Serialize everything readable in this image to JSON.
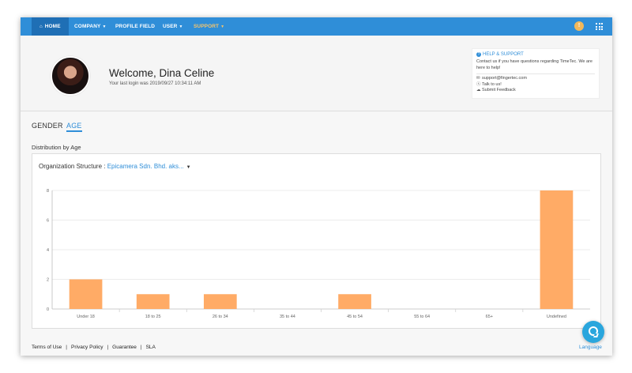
{
  "nav": {
    "home": "HOME",
    "company": "COMPANY",
    "profile_field": "PROFILE FIELD",
    "user": "USER",
    "support": "SUPPORT",
    "caret": "▼",
    "home_icon": "⌂"
  },
  "colors": {
    "nav_bg": "#2f8ed8",
    "nav_active": "#1f6fb5",
    "support_text": "#f6c56b",
    "bar": "#ffab66",
    "link": "#2f8ed8"
  },
  "welcome": {
    "title": "Welcome, Dina Celine",
    "last_login": "Your last login was 2019/09/27 10:34:11 AM"
  },
  "help": {
    "title": "HELP & SUPPORT",
    "description": "Contact us if you have questions regarding TimeTec. We are here to help!",
    "email": "support@fingertec.com",
    "talk": "Talk to us!",
    "feedback": "Submit Feedback",
    "icons": [
      "question-circle-icon",
      "envelope-icon",
      "skype-icon",
      "chat-bubbles-icon"
    ]
  },
  "tabs": {
    "gender": "GENDER",
    "age": "AGE",
    "active": "age"
  },
  "section_title": "Distribution by Age",
  "org": {
    "label": "Organization Structure : ",
    "value": "Epicamera Sdn. Bhd. aks...",
    "caret": "▼"
  },
  "chart_data": {
    "type": "bar",
    "categories": [
      "Under 18",
      "18 to 25",
      "26 to 34",
      "35 to 44",
      "45 to 54",
      "55 to 64",
      "65+",
      "Undefined"
    ],
    "values": [
      2,
      1,
      1,
      0,
      1,
      0,
      0,
      8
    ],
    "ylim": [
      0,
      8
    ],
    "yticks": [
      0,
      2,
      4,
      6,
      8
    ],
    "grid": true,
    "color": "#ffab66",
    "title": "",
    "xlabel": "",
    "ylabel": ""
  },
  "footer": {
    "terms": "Terms of Use",
    "privacy": "Privacy Policy",
    "guarantee": "Guarantee",
    "sla": "SLA",
    "separator": "|",
    "language": "Language"
  }
}
